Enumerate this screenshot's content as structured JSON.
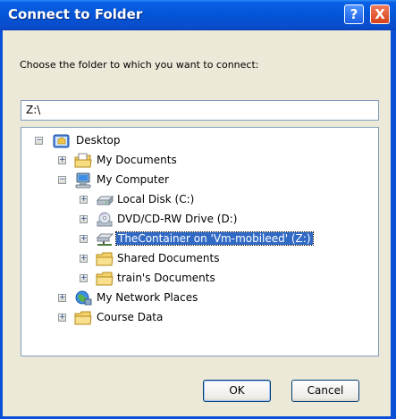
{
  "window": {
    "title": "Connect to Folder"
  },
  "title_buttons": {
    "help": "?",
    "close": "X"
  },
  "prompt": "Choose the folder to which you want to connect:",
  "path_value": "Z:\\",
  "tree": {
    "items": [
      {
        "label": "Desktop",
        "icon": "desktop-icon",
        "expander": "minus",
        "selected": false
      },
      {
        "label": "My Documents",
        "icon": "my-documents-icon",
        "expander": "plus",
        "selected": false
      },
      {
        "label": "My Computer",
        "icon": "my-computer-icon",
        "expander": "minus",
        "selected": false
      },
      {
        "label": "Local Disk (C:)",
        "icon": "local-disk-icon",
        "expander": "plus",
        "selected": false
      },
      {
        "label": "DVD/CD-RW Drive (D:)",
        "icon": "dvd-drive-icon",
        "expander": "plus",
        "selected": false
      },
      {
        "label": "TheContainer on 'Vm-mobileed' (Z:)",
        "icon": "network-drive-icon",
        "expander": "plus",
        "selected": true
      },
      {
        "label": "Shared Documents",
        "icon": "folder-icon",
        "expander": "plus",
        "selected": false
      },
      {
        "label": "train's Documents",
        "icon": "folder-icon",
        "expander": "plus",
        "selected": false
      },
      {
        "label": "My Network Places",
        "icon": "network-places-icon",
        "expander": "plus",
        "selected": false
      },
      {
        "label": "Course Data",
        "icon": "folder-icon",
        "expander": "plus",
        "selected": false
      }
    ]
  },
  "buttons": {
    "ok": "OK",
    "cancel": "Cancel"
  },
  "colors": {
    "titlebar": "#0356d8",
    "dialog_bg": "#ece9d8",
    "selection": "#316ac5"
  }
}
